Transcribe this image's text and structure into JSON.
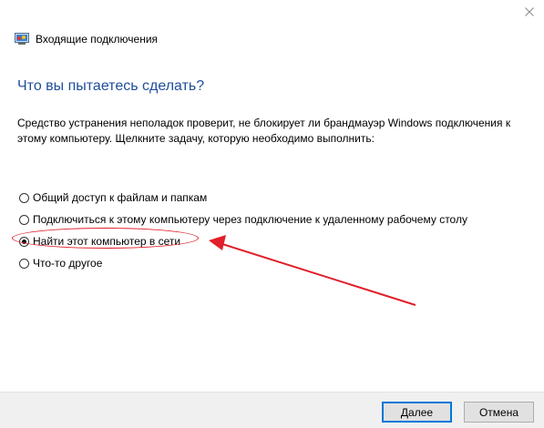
{
  "window": {
    "title": "Входящие подключения",
    "close_glyph": "✕"
  },
  "main": {
    "heading": "Что вы пытаетесь сделать?",
    "description": "Средство устранения неполадок проверит, не блокирует ли брандмауэр Windows подключения к этому компьютеру. Щелкните задачу, которую необходимо выполнить:",
    "options": [
      {
        "label": "Общий доступ к файлам и папкам",
        "selected": false
      },
      {
        "label": "Подключиться к этому компьютеру через подключение к удаленному рабочему столу",
        "selected": false
      },
      {
        "label": "Найти этот компьютер в сети",
        "selected": true
      },
      {
        "label": "Что-то другое",
        "selected": false
      }
    ]
  },
  "footer": {
    "next_label": "Далее",
    "cancel_label": "Отмена"
  },
  "annotation": {
    "color": "#e0202a",
    "icon": "red-arrow-icon"
  },
  "colors": {
    "heading": "#1f4e9c",
    "primary_button_border": "#0078d7"
  }
}
